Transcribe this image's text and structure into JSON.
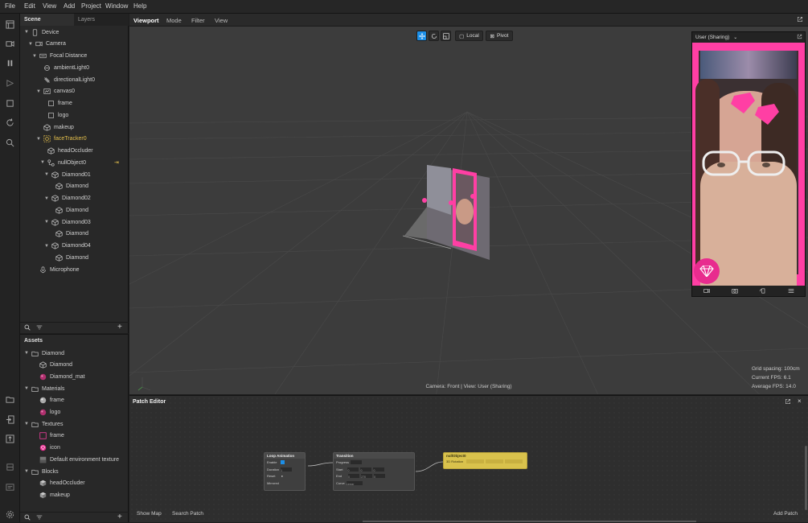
{
  "menu": [
    "File",
    "Edit",
    "View",
    "Add",
    "Project",
    "Window",
    "Help"
  ],
  "scene_panel": {
    "tab_scene": "Scene",
    "tab_layers": "Layers",
    "tree": [
      {
        "label": "Device",
        "depth": 0,
        "caret": true,
        "icon": "device-icon"
      },
      {
        "label": "Camera",
        "depth": 1,
        "caret": true,
        "icon": "camera-icon"
      },
      {
        "label": "Focal Distance",
        "depth": 2,
        "caret": true,
        "icon": "focal-icon"
      },
      {
        "label": "ambientLight0",
        "depth": 3,
        "caret": false,
        "icon": "ambient-light-icon"
      },
      {
        "label": "directionalLight0",
        "depth": 3,
        "caret": false,
        "icon": "directional-light-icon"
      },
      {
        "label": "canvas0",
        "depth": 3,
        "caret": true,
        "icon": "canvas-icon"
      },
      {
        "label": "frame",
        "depth": 4,
        "caret": false,
        "icon": "rectangle-icon"
      },
      {
        "label": "logo",
        "depth": 4,
        "caret": false,
        "icon": "rectangle-icon"
      },
      {
        "label": "makeup",
        "depth": 3,
        "caret": false,
        "icon": "mesh-icon"
      },
      {
        "label": "faceTracker0",
        "depth": 3,
        "caret": true,
        "icon": "face-tracker-icon",
        "yellow": true
      },
      {
        "label": "headOccluder",
        "depth": 4,
        "caret": false,
        "icon": "mesh-icon"
      },
      {
        "label": "nullObject0",
        "depth": 4,
        "caret": true,
        "icon": "null-object-icon"
      },
      {
        "label": "Diamond01",
        "depth": 5,
        "caret": true,
        "icon": "cube-icon"
      },
      {
        "label": "Diamond",
        "depth": 6,
        "caret": false,
        "icon": "mesh-icon"
      },
      {
        "label": "Diamond02",
        "depth": 5,
        "caret": true,
        "icon": "cube-icon"
      },
      {
        "label": "Diamond",
        "depth": 6,
        "caret": false,
        "icon": "mesh-icon"
      },
      {
        "label": "Diamond03",
        "depth": 5,
        "caret": true,
        "icon": "cube-icon"
      },
      {
        "label": "Diamond",
        "depth": 6,
        "caret": false,
        "icon": "mesh-icon"
      },
      {
        "label": "Diamond04",
        "depth": 5,
        "caret": true,
        "icon": "cube-icon"
      },
      {
        "label": "Diamond",
        "depth": 6,
        "caret": false,
        "icon": "mesh-icon"
      },
      {
        "label": "Microphone",
        "depth": 2,
        "caret": false,
        "icon": "microphone-icon"
      }
    ]
  },
  "assets_panel": {
    "title": "Assets",
    "tree": [
      {
        "label": "Diamond",
        "depth": 0,
        "caret": true,
        "icon": "folder-icon"
      },
      {
        "label": "Diamond",
        "depth": 1,
        "caret": false,
        "icon": "mesh-icon"
      },
      {
        "label": "Diamond_mat",
        "depth": 1,
        "caret": false,
        "icon": "material-pink-icon"
      },
      {
        "label": "Materials",
        "depth": 0,
        "caret": true,
        "icon": "folder-icon"
      },
      {
        "label": "frame",
        "depth": 1,
        "caret": false,
        "icon": "material-white-icon"
      },
      {
        "label": "logo",
        "depth": 1,
        "caret": false,
        "icon": "material-pink-icon"
      },
      {
        "label": "Textures",
        "depth": 0,
        "caret": true,
        "icon": "folder-icon"
      },
      {
        "label": "frame",
        "depth": 1,
        "caret": false,
        "icon": "texture-frame-icon"
      },
      {
        "label": "icon",
        "depth": 1,
        "caret": false,
        "icon": "texture-icon-icon"
      },
      {
        "label": "Default environment texture",
        "depth": 1,
        "caret": false,
        "icon": "texture-env-icon"
      },
      {
        "label": "Blocks",
        "depth": 0,
        "caret": true,
        "icon": "folder-icon"
      },
      {
        "label": "headOccluder",
        "depth": 1,
        "caret": false,
        "icon": "block-icon"
      },
      {
        "label": "makeup",
        "depth": 1,
        "caret": false,
        "icon": "block-icon"
      }
    ]
  },
  "viewport": {
    "tabs": [
      "Viewport",
      "Mode",
      "Filter",
      "View"
    ],
    "local_label": "Local",
    "pivot_label": "Pivot",
    "preview_device": "User (Sharing)",
    "camera_info": "Camera: Front | View: User (Sharing)",
    "stats": [
      "Grid spacing: 100cm",
      "Current FPS:  6.1",
      "Average FPS: 14.0"
    ]
  },
  "patch_editor": {
    "title": "Patch Editor",
    "show_map": "Show Map",
    "search_patch": "Search Patch",
    "add_patch": "Add Patch",
    "nodes": {
      "loop": {
        "title": "Loop Animation",
        "ports": [
          "Enable",
          "Duration",
          "Reset",
          "Mirrored"
        ],
        "duration": "1"
      },
      "transition": {
        "title": "Transition",
        "ports": [
          "Progress",
          "Start",
          "End",
          "Curve"
        ],
        "start": [
          "0",
          "0",
          "0"
        ],
        "end": [
          "0",
          "270",
          "0"
        ],
        "curve": "Linear"
      },
      "target": {
        "title": "nullObject0",
        "port": "3D Rotation"
      }
    }
  },
  "colors": {
    "accent": "#1c8fe8",
    "pink": "#ff3fa4",
    "yellow": "#e5c04c",
    "node_yellow": "#d9c24c"
  }
}
